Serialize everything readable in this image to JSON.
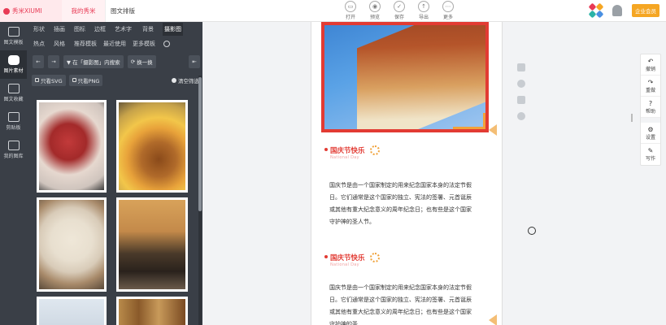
{
  "topbar": {
    "brand": "秀米XIUMI",
    "tab_mine": "我的秀米",
    "tab_typeset": "图文排版",
    "tools": [
      {
        "icon": "open-icon",
        "label": "打开"
      },
      {
        "icon": "preview-icon",
        "label": "预览"
      },
      {
        "icon": "save-icon",
        "label": "保存"
      },
      {
        "icon": "export-icon",
        "label": "导出"
      },
      {
        "icon": "more-icon",
        "label": "更多"
      }
    ],
    "enterprise": "企业会员"
  },
  "sidebar": {
    "items": [
      {
        "label": "图文模板",
        "icon": "template-icon"
      },
      {
        "label": "图片素材",
        "icon": "image-material-icon",
        "active": true
      },
      {
        "label": "图文收藏",
        "icon": "favorites-icon"
      },
      {
        "label": "剪贴板",
        "icon": "clipboard-icon"
      },
      {
        "label": "我的图库",
        "icon": "gallery-icon"
      }
    ]
  },
  "panel": {
    "categories_row1": [
      "形状",
      "插画",
      "图标",
      "边框",
      "艺术字",
      "背景",
      "摄影图"
    ],
    "categories_row2": [
      "热点",
      "风格",
      "推荐模板",
      "最近使用",
      "更多模板"
    ],
    "search_in_label": "▼ 在「摄影图」内搜索",
    "refresh_label": "换一换",
    "only_svg": "只看SVG",
    "only_png": "只看PNG",
    "clear_filter": "清空筛选",
    "thumbnails": [
      "sliced-meat-photo",
      "drinks-dessert-photo",
      "soup-bowl-photo",
      "clay-pot-photo",
      "sky-photo",
      "wood-texture-photo"
    ]
  },
  "document": {
    "section1_title": "国庆节快乐",
    "section1_subtitle": "National Day",
    "section1_text": "国庆节是由一个国家制定的用来纪念国家本身的法定节假日。它们通常是这个国家的独立、宪法的签署、元首诞辰或其他有重大纪念意义的周年纪念日；也有些是这个国家守护神的圣人节。",
    "section2_title": "国庆节快乐",
    "section2_subtitle": "National Day",
    "section2_text": "国庆节是由一个国家制定的用来纪念国家本身的法定节假日。它们通常是这个国家的独立、宪法的签署、元首诞辰或其他有重大纪念意义的周年纪念日；也有些是这个国家守护神的圣"
  },
  "right_tools": [
    {
      "icon": "undo-icon",
      "label": "撤销"
    },
    {
      "icon": "redo-icon",
      "label": "重做"
    },
    {
      "icon": "help-icon",
      "label": "帮助"
    },
    {
      "icon": "settings-icon",
      "label": "设置"
    },
    {
      "icon": "write-icon",
      "label": "写作"
    }
  ],
  "colors": {
    "accent": "#e23b33",
    "brand": "#e83a55",
    "sidebar_bg": "#3a3f47"
  }
}
